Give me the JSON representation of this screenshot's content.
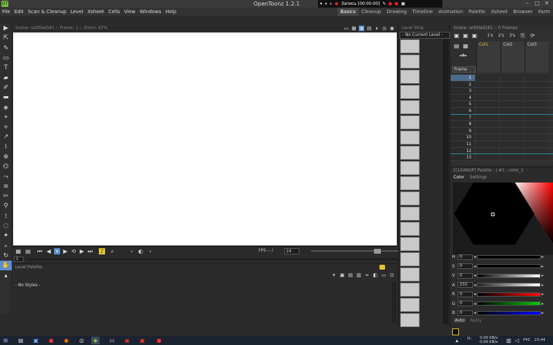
{
  "window": {
    "title": "OpenToonz 1.2.1",
    "logo": "OT"
  },
  "recorder": {
    "label": "Запись [00:00:00]"
  },
  "menu": [
    "File",
    "Edit",
    "Scan & Cleanup",
    "Level",
    "Xsheet",
    "Cells",
    "View",
    "Windows",
    "Help"
  ],
  "rooms": [
    {
      "label": "Basics",
      "active": true
    },
    {
      "label": "Cleanup",
      "active": false
    },
    {
      "label": "Drawing",
      "active": false
    },
    {
      "label": "Timeline",
      "active": false
    },
    {
      "label": "Animation",
      "active": false
    },
    {
      "label": "Palette",
      "active": false
    },
    {
      "label": "Xsheet",
      "active": false
    },
    {
      "label": "Browser",
      "active": false
    },
    {
      "label": "Farm",
      "active": false
    }
  ],
  "tools": [
    "animate-tool",
    "selection-tool",
    "brush-tool",
    "geometric-tool",
    "type-tool",
    "fill-tool",
    "paint-brush-tool",
    "eraser-tool",
    "tape-tool",
    "style-picker-tool",
    "rgb-picker-tool",
    "control-point-editor-tool",
    "pinch-tool",
    "pump-tool",
    "magnet-tool",
    "bender-tool",
    "iron-tool",
    "cutter-tool",
    "skeleton-tool",
    "tracker-tool",
    "hook-tool",
    "plastic-tool",
    "zoom-tool",
    "rotate-tool",
    "hand-tool",
    "more-tools"
  ],
  "viewer": {
    "header": "Scene: untitled181  ::  Frame: 1  ::  Zoom: 67%"
  },
  "playback": {
    "fps_label": "FPS -- /",
    "fps_value": "24",
    "frame": "1"
  },
  "level_palette": {
    "title": "Level Palette:",
    "empty_text": "- No Styles -"
  },
  "level_strip": {
    "title": "Level Strip",
    "combo": "- No Current Level -"
  },
  "xsheet": {
    "scene": "Scene: untitled181  ::  0 Frames",
    "columns": [
      "Col1",
      "Col2",
      "Col3"
    ],
    "frame_header": "Frame",
    "frames": [
      "1",
      "2",
      "3",
      "4",
      "5",
      "6",
      "7",
      "8",
      "9",
      "10",
      "11",
      "12",
      "13"
    ],
    "toggles": [
      "1's",
      "2's",
      "3's"
    ]
  },
  "style_editor": {
    "title": "[CLEANUP]  Palette : | #1 : color_1",
    "tabs": [
      "Color",
      "Settings"
    ],
    "channels": [
      {
        "label": "H",
        "value": "0"
      },
      {
        "label": "S",
        "value": "0"
      },
      {
        "label": "V",
        "value": "0"
      },
      {
        "label": "A",
        "value": "255"
      },
      {
        "label": "R",
        "value": "0"
      },
      {
        "label": "G",
        "value": "0"
      },
      {
        "label": "B",
        "value": "0"
      }
    ],
    "auto_label": "Auto",
    "apply_label": "Apply"
  },
  "taskbar": {
    "disk": "D:",
    "net_up": "0,00 KB/s",
    "net_down": "0,00 KB/s",
    "lang": "РУС",
    "time": "23:44"
  },
  "colors": {
    "accent": "#5b8fd1",
    "highlight": "#e6c62e"
  }
}
